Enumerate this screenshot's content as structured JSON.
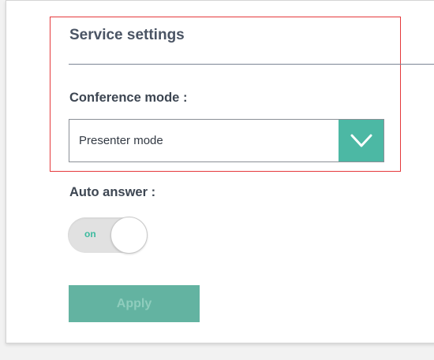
{
  "section": {
    "title": "Service settings"
  },
  "conference_mode": {
    "label": "Conference mode :",
    "selected": "Presenter mode",
    "arrow_icon": "chevron-down-icon"
  },
  "auto_answer": {
    "label": "Auto answer :",
    "toggle_text": "on",
    "state": "on"
  },
  "apply": {
    "label": "Apply",
    "enabled": false
  },
  "colors": {
    "accent": "#4cb8a4",
    "highlight_border": "#e5393c",
    "apply_background": "#63b3a1",
    "toggle_text": "#3dbb9f"
  }
}
